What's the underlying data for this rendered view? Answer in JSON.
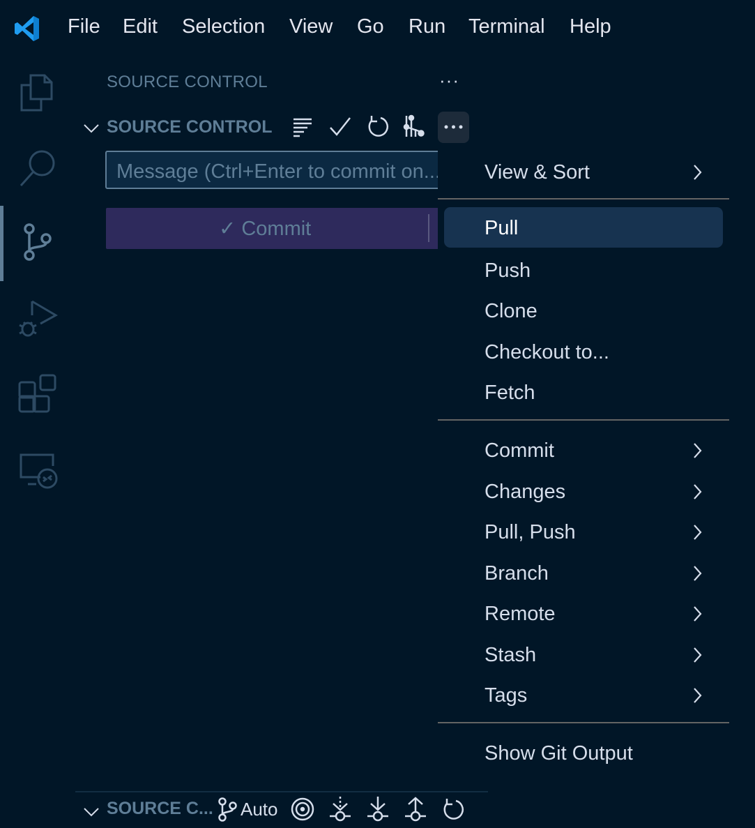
{
  "menubar": {
    "logo": "vscode-logo-icon",
    "items": [
      "File",
      "Edit",
      "Selection",
      "View",
      "Go",
      "Run",
      "Terminal",
      "Help"
    ]
  },
  "activity_bar": {
    "items": [
      {
        "name": "explorer",
        "icon": "files-icon",
        "active": false
      },
      {
        "name": "search",
        "icon": "search-icon",
        "active": false
      },
      {
        "name": "source-control",
        "icon": "source-control-icon",
        "active": true
      },
      {
        "name": "run-debug",
        "icon": "debug-run-icon",
        "active": false
      },
      {
        "name": "extensions",
        "icon": "extensions-icon",
        "active": false
      },
      {
        "name": "remote-explorer",
        "icon": "remote-explorer-icon",
        "active": false
      }
    ]
  },
  "panel": {
    "title": "SOURCE CONTROL",
    "more": "···",
    "section": {
      "title": "SOURCE CONTROL",
      "toolbar": [
        "view-as-tree-icon",
        "commit-check-icon",
        "refresh-icon",
        "graph-icon",
        "more-actions-icon"
      ]
    },
    "commit_input": {
      "placeholder": "Message (Ctrl+Enter to commit on..."
    },
    "commit_button": {
      "label": "✓ Commit"
    }
  },
  "bottom_section": {
    "title": "SOURCE C...",
    "branch_label": "Auto",
    "icons": [
      "branch-icon",
      "target-icon",
      "fetch-icon",
      "pull-icon",
      "push-icon",
      "refresh-icon"
    ]
  },
  "context_menu": {
    "groups": [
      [
        {
          "label": "View & Sort",
          "submenu": true
        }
      ],
      [
        {
          "label": "Pull",
          "submenu": false,
          "highlighted": true
        },
        {
          "label": "Push",
          "submenu": false
        },
        {
          "label": "Clone",
          "submenu": false
        },
        {
          "label": "Checkout to...",
          "submenu": false
        },
        {
          "label": "Fetch",
          "submenu": false
        }
      ],
      [
        {
          "label": "Commit",
          "submenu": true
        },
        {
          "label": "Changes",
          "submenu": true
        },
        {
          "label": "Pull, Push",
          "submenu": true
        },
        {
          "label": "Branch",
          "submenu": true
        },
        {
          "label": "Remote",
          "submenu": true
        },
        {
          "label": "Stash",
          "submenu": true
        },
        {
          "label": "Tags",
          "submenu": true
        }
      ],
      [
        {
          "label": "Show Git Output",
          "submenu": false
        }
      ]
    ]
  },
  "colors": {
    "background": "#011627",
    "accent_muted": "#5f7e97",
    "highlight": "#173350",
    "commit_button": "#2e2a5c",
    "vscode_blue": "#1f9cf0"
  }
}
